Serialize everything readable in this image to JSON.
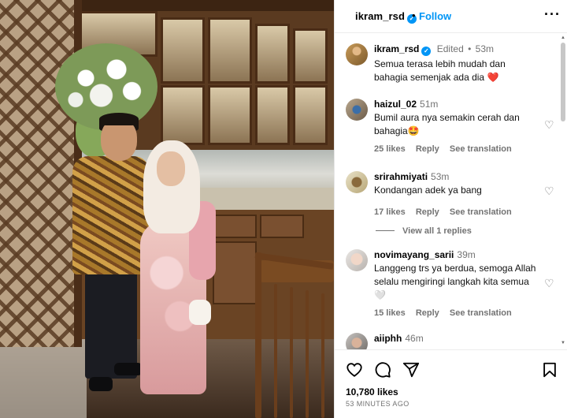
{
  "post": {
    "author": "ikram_rsd",
    "follow_label": "Follow",
    "separator": "•",
    "more_icon": "more-horizontal-icon",
    "verified_icon": "verified-badge-icon",
    "caption": {
      "author": "ikram_rsd",
      "edited_label": "Edited",
      "time": "53m",
      "text": "Semua terasa lebih mudah dan bahagia semenjak ada dia",
      "emoji": "❤️"
    },
    "view_replies_label": "View all 1 replies",
    "likes": "10,780 likes",
    "posted_ago": "53 MINUTES AGO"
  },
  "comments": [
    {
      "user": "haizul_02",
      "time": "51m",
      "text": "Bumil aura nya semakin cerah dan bahagia",
      "emoji": "🤩",
      "likes": "25 likes",
      "reply": "Reply",
      "translate": "See translation"
    },
    {
      "user": "srirahmiyati",
      "time": "53m",
      "text": "Kondangan adek ya bang",
      "emoji": "",
      "likes": "17 likes",
      "reply": "Reply",
      "translate": "See translation"
    },
    {
      "user": "novimayang_sarii",
      "time": "39m",
      "text": "Langgeng trs ya berdua, semoga Allah selalu mengiringi langkah kita semua",
      "emoji": "🤍",
      "likes": "15 likes",
      "reply": "Reply",
      "translate": "See translation"
    },
    {
      "user": "aiiphh",
      "time": "46m",
      "text": "",
      "emoji": "",
      "likes": "",
      "reply": "",
      "translate": ""
    }
  ],
  "icons": {
    "like": "heart-icon",
    "comment": "comment-icon",
    "share": "send-icon",
    "save": "bookmark-icon"
  },
  "colors": {
    "accent": "#0095f6",
    "secondary_text": "#737373",
    "heart_red": "#ed4956"
  }
}
